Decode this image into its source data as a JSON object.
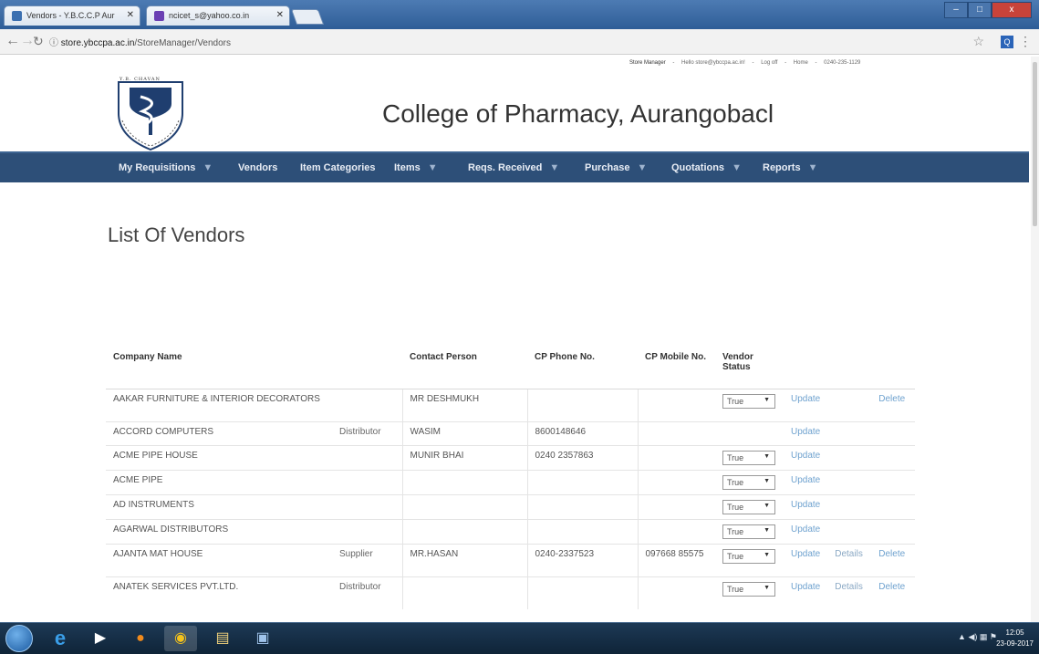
{
  "browser": {
    "tabs": [
      {
        "title": "Vendors - Y.B.C.C.P Aur"
      },
      {
        "title": "ncicet_s@yahoo.co.in"
      }
    ],
    "url_host": "store.ybccpa.ac.in",
    "url_path": "/StoreManager/Vendors",
    "window_buttons": [
      "–",
      "□",
      "x"
    ]
  },
  "header": {
    "logo_caption": "Y.B. CHAVAN",
    "college_name": "College of Pharmacy, Aurangobacl",
    "links": {
      "role": "Store Manager",
      "greeting": "Hello store@ybccpa.ac.in!",
      "logoff": "Log off",
      "home": "Home",
      "phone": "0240-235-1129"
    }
  },
  "nav": [
    {
      "label": "My Requisitions",
      "caret": "▼"
    },
    {
      "label": "Vendors",
      "caret": ""
    },
    {
      "label": "Item Categories",
      "caret": ""
    },
    {
      "label": "Items",
      "caret": "▼"
    },
    {
      "label": "Reqs. Received",
      "caret": "▼"
    },
    {
      "label": "Purchase",
      "caret": "▼"
    },
    {
      "label": "Quotations",
      "caret": "▼"
    },
    {
      "label": "Reports",
      "caret": "▼"
    }
  ],
  "page": {
    "heading": "List Of Vendors"
  },
  "table": {
    "columns": {
      "company": "Company Name",
      "contact": "Contact Person",
      "phone": "CP Phone No.",
      "mobile": "CP Mobile No.",
      "status": "Vendor Status"
    },
    "rows": [
      {
        "company": "AAKAR FURNITURE & INTERIOR DECORATORS",
        "type": "",
        "contact": "MR DESHMUKH",
        "phone": "",
        "mobile": "",
        "status": "True",
        "update": "Update",
        "details": "",
        "delete": "Delete"
      },
      {
        "company": "ACCORD COMPUTERS",
        "type": "Distributor",
        "contact": "WASIM",
        "phone": "8600148646",
        "mobile": "",
        "status": "",
        "update": "Update",
        "details": "",
        "delete": ""
      },
      {
        "company": "ACME PIPE HOUSE",
        "type": "",
        "contact": "MUNIR BHAI",
        "phone": "0240 2357863",
        "mobile": "",
        "status": "True",
        "update": "Update",
        "details": "",
        "delete": ""
      },
      {
        "company": "ACME PIPE",
        "type": "",
        "contact": "",
        "phone": "",
        "mobile": "",
        "status": "True",
        "update": "Update",
        "details": "",
        "delete": ""
      },
      {
        "company": "AD INSTRUMENTS",
        "type": "",
        "contact": "",
        "phone": "",
        "mobile": "",
        "status": "True",
        "update": "Update",
        "details": "",
        "delete": ""
      },
      {
        "company": "AGARWAL DISTRIBUTORS",
        "type": "",
        "contact": "",
        "phone": "",
        "mobile": "",
        "status": "True",
        "update": "Update",
        "details": "",
        "delete": ""
      },
      {
        "company": "AJANTA MAT HOUSE",
        "type": "Supplier",
        "contact": "MR.HASAN",
        "phone": "0240-2337523",
        "mobile": "097668 85575",
        "status": "True",
        "update": "Update",
        "details": "Details",
        "delete": "Delete"
      },
      {
        "company": "ANATEK SERVICES PVT.LTD.",
        "type": "Distributor",
        "contact": "",
        "phone": "",
        "mobile": "",
        "status": "True",
        "update": "Update",
        "details": "Details",
        "delete": "Delete"
      }
    ]
  },
  "taskbar": {
    "time": "12:05",
    "date": "23-09-2017"
  }
}
